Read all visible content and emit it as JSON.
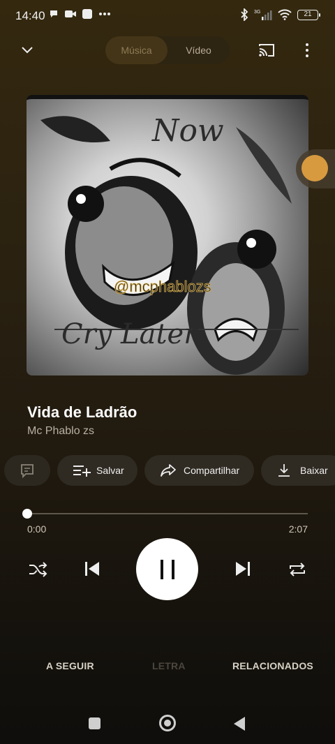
{
  "status_bar": {
    "time": "14:40",
    "battery": "21",
    "network": "3G"
  },
  "header": {
    "tabs": [
      {
        "label": "Música",
        "active": true
      },
      {
        "label": "Vídeo",
        "active": false
      }
    ]
  },
  "album_art": {
    "watermark": "@mcphablozs",
    "art_text_top": "Now",
    "art_text_bottom": "Cry Later"
  },
  "song": {
    "title": "Vida de Ladrão",
    "artist": "Mc Phablo zs"
  },
  "actions": {
    "save_label": "Salvar",
    "share_label": "Compartilhar",
    "download_label": "Baixar"
  },
  "player": {
    "elapsed": "0:00",
    "duration": "2:07",
    "progress_fraction": 0.0
  },
  "bottom_tabs": {
    "up_next": "A SEGUIR",
    "lyrics": "LETRA",
    "related": "RELACIONADOS"
  },
  "colors": {
    "background_top": "#34280f",
    "accent_bubble": "#d89a3f"
  }
}
